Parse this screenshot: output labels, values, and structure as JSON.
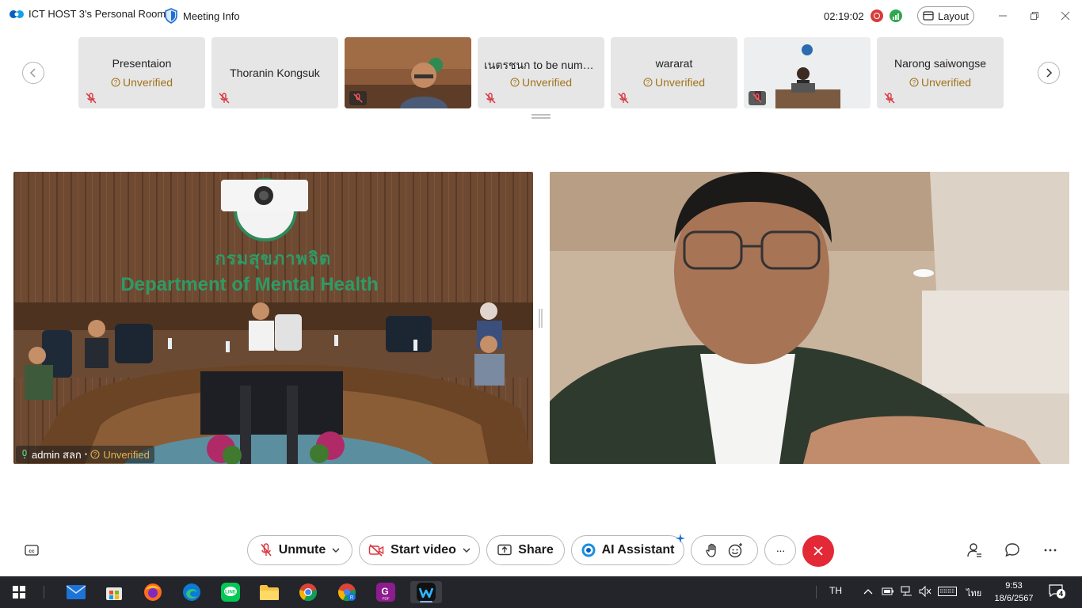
{
  "titlebar": {
    "room_title": "ICT HOST 3's Personal Room",
    "meeting_info": "Meeting Info",
    "timer": "02:19:02",
    "layout_label": "Layout",
    "colors": {
      "record": "#d83b3b",
      "signal": "#2fa84f",
      "brand": "#0a5fc4"
    }
  },
  "filmstrip": {
    "tiles": [
      {
        "name": "Presentaion",
        "status": "Unverified",
        "has_video": false
      },
      {
        "name": "Thoranin Kongsuk",
        "status": "",
        "has_video": false
      },
      {
        "name": "",
        "status": "",
        "has_video": true
      },
      {
        "name": "เนตรชนก to be numb...",
        "status": "Unverified",
        "has_video": false
      },
      {
        "name": "wararat",
        "status": "Unverified",
        "has_video": false
      },
      {
        "name": "",
        "status": "",
        "has_video": true
      },
      {
        "name": "Narong saiwongse",
        "status": "Unverified",
        "has_video": false
      }
    ]
  },
  "main": {
    "left_video": {
      "sign_thai": "กรมสุขภาพจิต",
      "sign_english": "Department of Mental Health",
      "name": "admin สลก",
      "status": "Unverified"
    }
  },
  "toolbar": {
    "unmute": "Unmute",
    "start_video": "Start video",
    "share": "Share",
    "ai_assistant": "AI Assistant",
    "more": "···"
  },
  "taskbar": {
    "language": "TH",
    "ime": "ไทย",
    "time": "9:53",
    "date": "18/6/2567",
    "notifications": "4"
  }
}
